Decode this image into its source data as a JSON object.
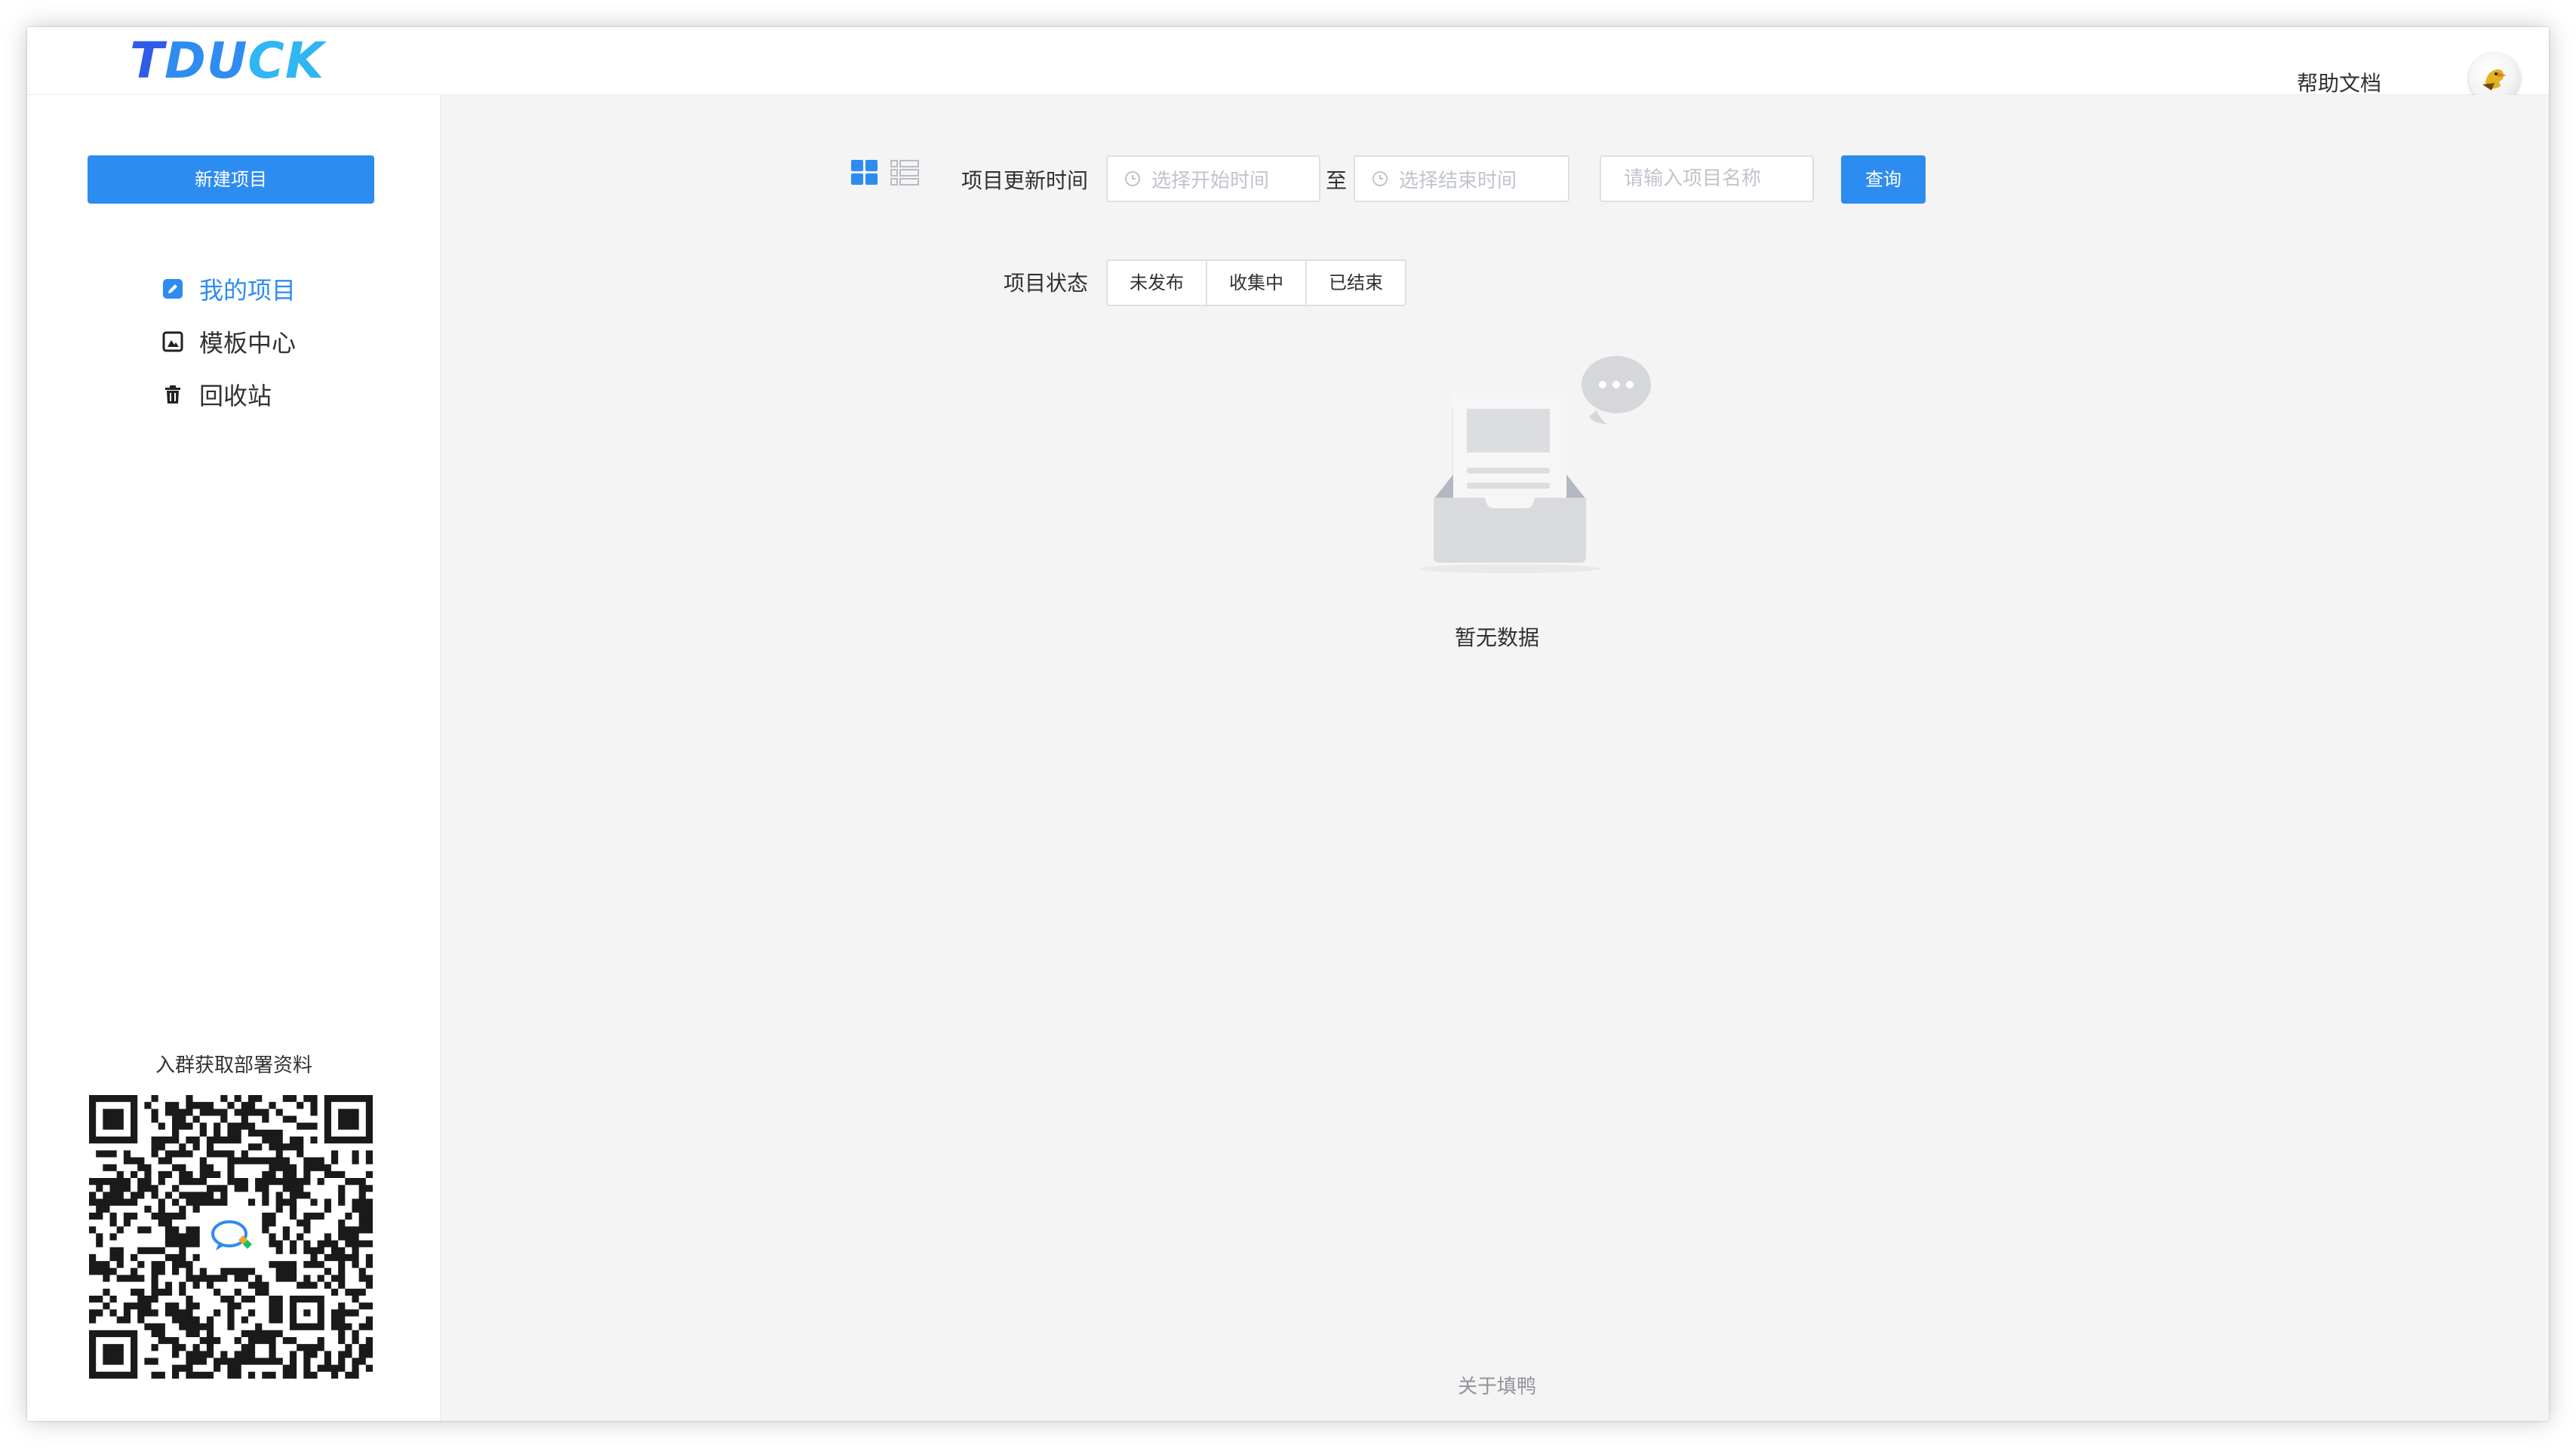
{
  "app": {
    "logo_text_1": "T",
    "logo_text_2": "DU",
    "logo_text_3": "CK",
    "help_link": "帮助文档",
    "avatar_icon": "duck-avatar-icon"
  },
  "sidebar": {
    "new_project_button": "新建项目",
    "items": [
      {
        "label": "我的项目",
        "icon": "edit-icon",
        "active": true
      },
      {
        "label": "模板中心",
        "icon": "template-icon",
        "active": false
      },
      {
        "label": "回收站",
        "icon": "trash-icon",
        "active": false
      }
    ],
    "qr_title": "入群获取部署资料"
  },
  "filters": {
    "view_modes": [
      "grid-view-icon",
      "list-view-icon"
    ],
    "update_time_label": "项目更新时间",
    "start_placeholder": "选择开始时间",
    "to_label": "至",
    "end_placeholder": "选择结束时间",
    "name_placeholder": "请输入项目名称",
    "query_button": "查询",
    "status_label": "项目状态",
    "status_options": [
      "未发布",
      "收集中",
      "已结束"
    ]
  },
  "empty": {
    "text": "暂无数据"
  },
  "footer": {
    "about": "关于填鸭"
  },
  "colors": {
    "primary": "#2d8cf0",
    "logo_dark": "#2f5ce6",
    "logo_light": "#30b6f2",
    "background": "#f4f4f4"
  }
}
